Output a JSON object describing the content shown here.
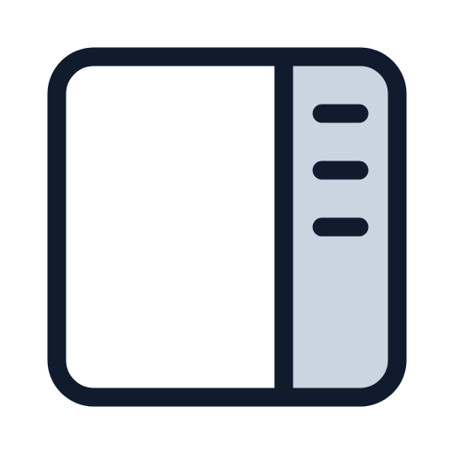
{
  "icon": {
    "name": "sidebar-right-menu-icon",
    "stroke_color": "#111B2E",
    "panel_fill": "#CBD5E1",
    "main_fill": "#FFFFFF",
    "menu_lines": 3
  }
}
